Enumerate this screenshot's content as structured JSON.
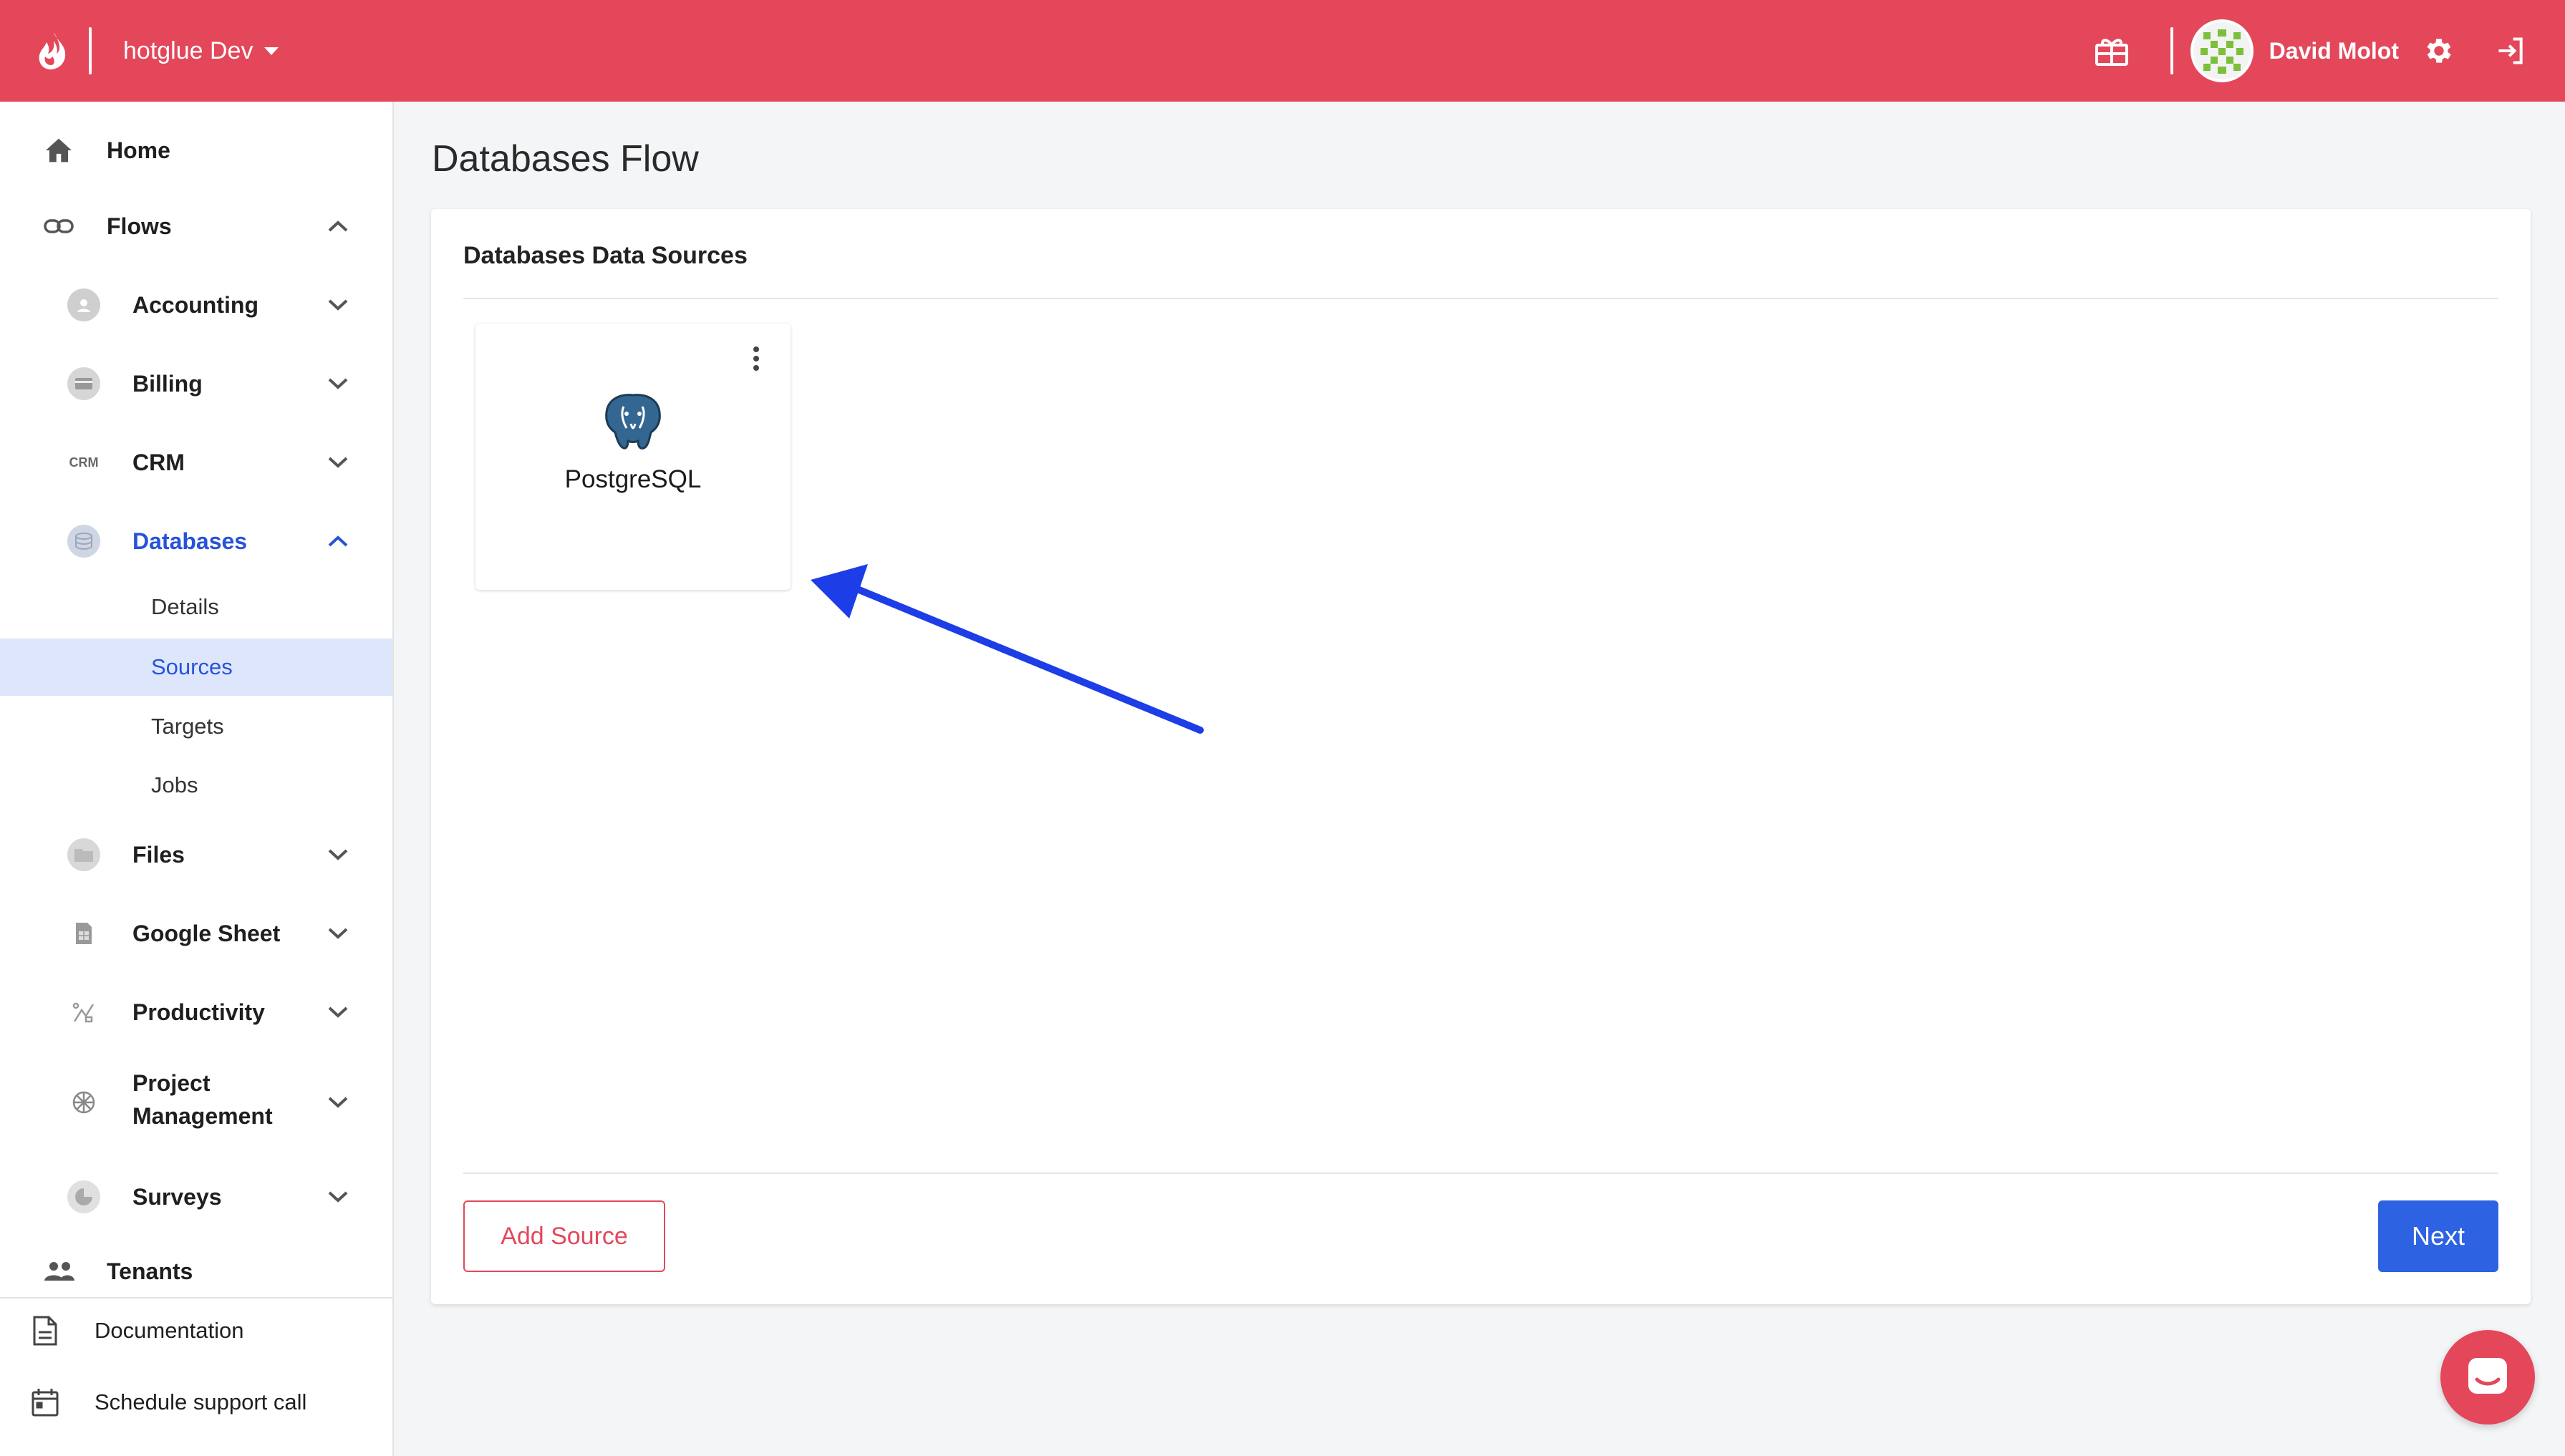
{
  "header": {
    "workspace": "hotglue Dev",
    "user_name": "David Molot",
    "brand_color": "#e4475a"
  },
  "sidebar": {
    "top_items": [
      {
        "label": "Home",
        "icon": "home-icon"
      },
      {
        "label": "Flows",
        "icon": "link-icon",
        "expanded": true
      }
    ],
    "flows": [
      {
        "label": "Accounting",
        "icon": "accounting-icon",
        "expanded": false
      },
      {
        "label": "Billing",
        "icon": "billing-icon",
        "expanded": false
      },
      {
        "label": "CRM",
        "icon": "crm-icon",
        "icon_text": "CRM",
        "expanded": false
      },
      {
        "label": "Databases",
        "icon": "databases-icon",
        "expanded": true,
        "active": true
      },
      {
        "label": "Files",
        "icon": "files-icon",
        "expanded": false
      },
      {
        "label": "Google Sheet",
        "icon": "google-sheet-icon",
        "expanded": false
      },
      {
        "label": "Productivity",
        "icon": "productivity-icon",
        "expanded": false
      },
      {
        "label": "Project Management",
        "icon": "project-management-icon",
        "expanded": false
      },
      {
        "label": "Surveys",
        "icon": "surveys-icon",
        "expanded": false
      }
    ],
    "databases_subitems": [
      {
        "label": "Details",
        "active": false
      },
      {
        "label": "Sources",
        "active": true
      },
      {
        "label": "Targets",
        "active": false
      },
      {
        "label": "Jobs",
        "active": false
      }
    ],
    "tenants": {
      "label": "Tenants",
      "icon": "people-icon"
    },
    "bottom_items": [
      {
        "label": "Documentation",
        "icon": "document-icon"
      },
      {
        "label": "Schedule support call",
        "icon": "calendar-icon"
      }
    ]
  },
  "main": {
    "page_title": "Databases Flow",
    "card_title": "Databases Data Sources",
    "sources": [
      {
        "name": "PostgreSQL",
        "icon": "postgresql-icon"
      }
    ],
    "add_source_label": "Add Source",
    "next_label": "Next",
    "accent_color": "#2d63e2"
  }
}
